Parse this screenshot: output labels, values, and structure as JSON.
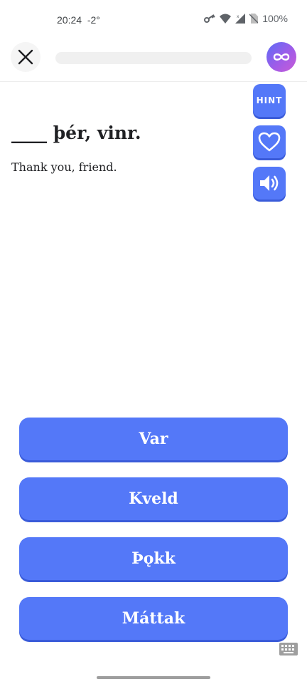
{
  "status_bar": {
    "time": "20:24",
    "temperature": "-2°",
    "battery": "100%",
    "icons": [
      "key-icon",
      "wifi-icon",
      "signal-icon",
      "no-sim-icon"
    ]
  },
  "top_bar": {
    "close_icon": "close-icon",
    "progress": 0,
    "infinity_icon": "infinity-icon"
  },
  "side_actions": {
    "hint_label": "HINT",
    "heart_icon": "heart-icon",
    "sound_icon": "speaker-icon"
  },
  "prompt": {
    "sentence": "____ þér, vinr.",
    "translation": "Thank you, friend."
  },
  "answers": [
    "Var",
    "Kveld",
    "Þǫkk",
    "Máttak"
  ],
  "colors": {
    "accent": "#5478f8",
    "accent_shadow": "#3a5bd9",
    "infinity_gradient_start": "#5b6cf7",
    "infinity_gradient_end": "#c85bd6"
  }
}
